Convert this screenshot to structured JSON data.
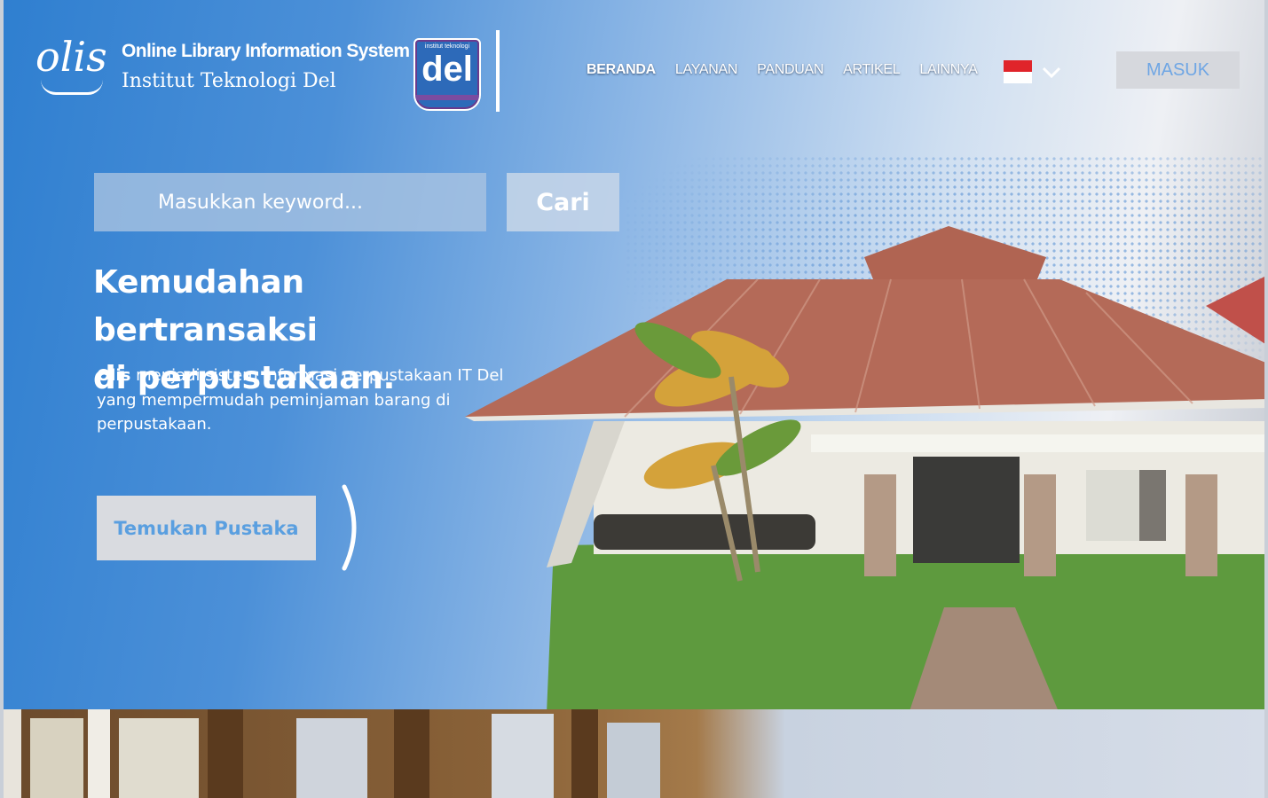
{
  "header": {
    "logo_text": "olis",
    "brand_title": "Online Library Information System",
    "brand_subtitle": "Institut Teknologi Del",
    "partner_logo_small": "institut teknologi",
    "partner_logo_text": "del",
    "nav": [
      {
        "label": "BERANDA",
        "active": true
      },
      {
        "label": "LAYANAN",
        "active": false
      },
      {
        "label": "PANDUAN",
        "active": false
      },
      {
        "label": "ARTIKEL",
        "active": false
      },
      {
        "label": "LAINNYA",
        "active": false
      }
    ],
    "language_flag": "indonesia-flag-icon",
    "login_label": "MASUK"
  },
  "search": {
    "placeholder": "Masukkan keyword...",
    "button_label": "Cari"
  },
  "hero": {
    "headline_line1": "Kemudahan bertransaksi",
    "headline_line2": "di perpustakaan.",
    "description_bold": "Olis",
    "description_rest": " menjadi sistem informasi perpustakaan IT Del yang mempermudah peminjaman barang di perpustakaan.",
    "cta_label": "Temukan Pustaka"
  },
  "colors": {
    "primary_blue": "#2f7fd0",
    "button_grey": "#d9dbe0",
    "accent_text_blue": "#5a9fe0",
    "flag_red": "#e0242a"
  }
}
